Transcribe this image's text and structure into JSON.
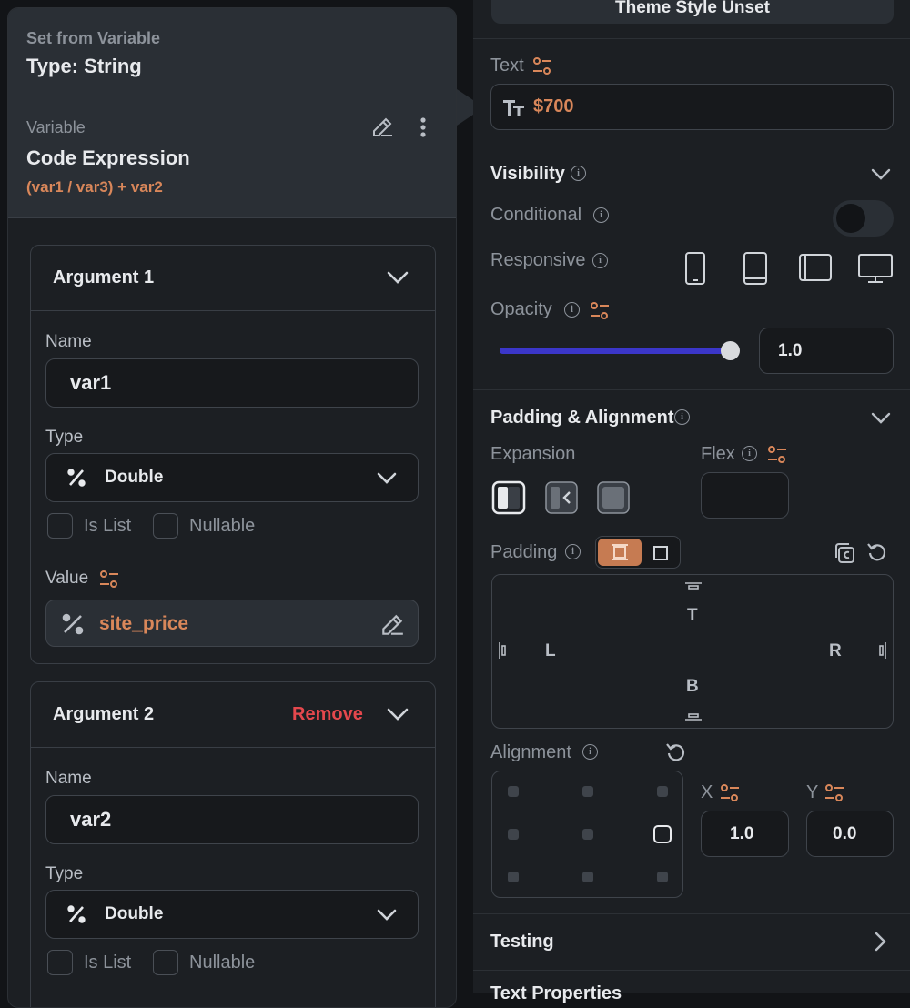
{
  "variable_panel": {
    "header": {
      "title": "Set from Variable",
      "type_label": "Type: String"
    },
    "variable": {
      "label": "Variable",
      "name": "Code Expression",
      "expression": "(var1 / var3) + var2"
    },
    "arguments": [
      {
        "title": "Argument 1",
        "name_label": "Name",
        "name_value": "var1",
        "type_label": "Type",
        "type_value": "Double",
        "is_list_label": "Is List",
        "nullable_label": "Nullable",
        "value_label": "Value",
        "value": "site_price"
      },
      {
        "title": "Argument 2",
        "remove_label": "Remove",
        "name_label": "Name",
        "name_value": "var2",
        "type_label": "Type",
        "type_value": "Double",
        "is_list_label": "Is List",
        "nullable_label": "Nullable"
      }
    ]
  },
  "properties_panel": {
    "theme_button_label": "Theme Style Unset",
    "text": {
      "label": "Text",
      "value": "$700"
    },
    "visibility": {
      "title": "Visibility",
      "conditional_label": "Conditional",
      "conditional_on": false,
      "responsive_label": "Responsive",
      "devices": [
        "phone-icon",
        "tablet-icon",
        "tablet-landscape-icon",
        "desktop-icon"
      ],
      "opacity_label": "Opacity",
      "opacity_value": "1.0",
      "opacity_fraction": 1.0
    },
    "padding_alignment": {
      "title": "Padding & Alignment",
      "expansion_label": "Expansion",
      "flex_label": "Flex",
      "padding_label": "Padding",
      "padding_sides": {
        "top": "T",
        "left": "L",
        "right": "R",
        "bottom": "B"
      },
      "alignment_label": "Alignment",
      "x_label": "X",
      "x_value": "1.0",
      "y_label": "Y",
      "y_value": "0.0"
    },
    "testing": {
      "title": "Testing"
    },
    "next_section_partial": "Text Properties"
  },
  "colors": {
    "accent": "#d9875a",
    "slider": "#3b36c9",
    "danger": "#e5484d"
  }
}
